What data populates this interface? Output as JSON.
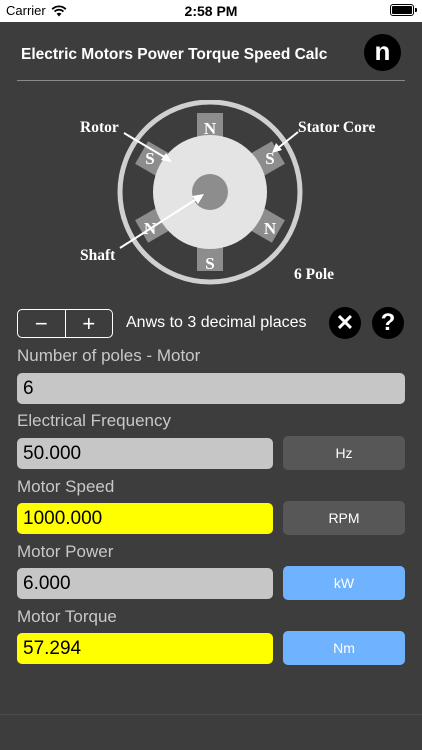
{
  "status": {
    "carrier": "Carrier",
    "time": "2:58 PM"
  },
  "header": {
    "title": "Electric Motors Power Torque Speed Calc",
    "logo_letter": "n"
  },
  "diagram": {
    "rotor_label": "Rotor",
    "stator_label": "Stator Core",
    "shaft_label": "Shaft",
    "pole_label": "6 Pole",
    "poles": [
      "N",
      "S",
      "N",
      "S",
      "N",
      "S"
    ]
  },
  "controls": {
    "minus": "−",
    "plus": "+",
    "decimals_text": "Anws to 3 decimal places",
    "clear": "✕",
    "help": "?"
  },
  "fields": {
    "poles": {
      "label": "Number of poles - Motor",
      "value": "6"
    },
    "frequency": {
      "label": "Electrical Frequency",
      "value": "50.000",
      "unit": "Hz"
    },
    "speed": {
      "label": "Motor Speed",
      "value": "1000.000",
      "unit": "RPM"
    },
    "power": {
      "label": "Motor Power",
      "value": "6.000",
      "unit": "kW"
    },
    "torque": {
      "label": "Motor Torque",
      "value": "57.294",
      "unit": "Nm"
    }
  },
  "colors": {
    "background": "#3d3d3d",
    "input_gray": "#c6c6c6",
    "result_yellow": "#ffff00",
    "unit_dark": "#575757",
    "unit_blue": "#6fb3ff"
  }
}
